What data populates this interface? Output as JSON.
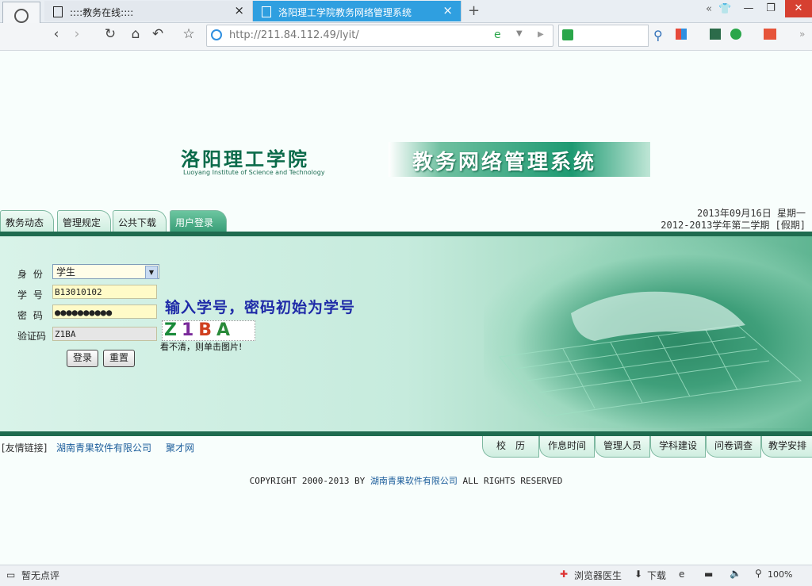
{
  "browser": {
    "tabs": [
      {
        "title": "::::教务在线::::",
        "active": false
      },
      {
        "title": "洛阳理工学院教务网络管理系统",
        "active": true
      }
    ],
    "url_prefix": "http://211.84.112.49",
    "url_path": "/lyit/",
    "icons": {
      "back": "chevron-left-icon",
      "forward": "chevron-right-icon",
      "refresh": "refresh-icon",
      "home": "home-icon",
      "undo": "undo-icon",
      "favorite": "star-icon"
    },
    "status": {
      "comments": "暂无点评",
      "doctor": "浏览器医生",
      "download": "下载",
      "zoom": "100%"
    }
  },
  "page": {
    "school_name": "洛阳理工学院",
    "school_name_en": "Luoyang Institute of Science and Technology",
    "system_name": "教务网络管理系统",
    "top_tabs": [
      "教务动态",
      "管理规定",
      "公共下载",
      "用户登录"
    ],
    "date": "2013年09月16日 星期一",
    "term": "2012-2013学年第二学期 [假期]",
    "login": {
      "role_label": "身 份",
      "role_value": "学生",
      "id_label": "学 号",
      "id_value": "B13010102",
      "password_label": "密 码",
      "password_value": "●●●●●●●●●●",
      "captcha_label": "验证码",
      "captcha_value": "Z1BA",
      "captcha_image_text": "Z1BA",
      "captcha_note": "看不清，则单击图片!",
      "login_button": "登录",
      "reset_button": "重置",
      "hint": "输入学号，密码初始为学号"
    },
    "friend_links_label": "[友情链接]",
    "friend_links": [
      "湖南青果软件有限公司",
      "聚才网"
    ],
    "bottom_tabs": [
      "校　历",
      "作息时间",
      "管理人员",
      "学科建设",
      "问卷调查",
      "教学安排"
    ],
    "copyright_prefix": "COPYRIGHT 2000-2013 BY ",
    "copyright_company": "湖南青果软件有限公司",
    "copyright_suffix": " ALL RIGHTS RESERVED"
  }
}
